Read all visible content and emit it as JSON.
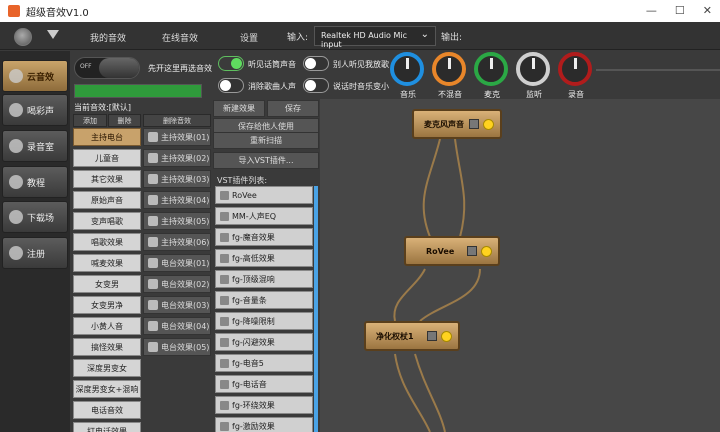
{
  "window": {
    "title": "超级音效V1.0"
  },
  "topbar": {
    "tabs": [
      "我的音效",
      "在线音效",
      "设置"
    ],
    "input_label": "输入:",
    "input_device": "Realtek HD Audio Mic input",
    "output_label": "输出:"
  },
  "sidebar": {
    "items": [
      {
        "label": "云音效",
        "icon": "cloud-icon",
        "active": true
      },
      {
        "label": "喝彩声",
        "icon": "clap-icon",
        "active": false
      },
      {
        "label": "录音室",
        "icon": "mic-icon",
        "active": false
      },
      {
        "label": "教程",
        "icon": "book-icon",
        "active": false
      },
      {
        "label": "下载场",
        "icon": "download-icon",
        "active": false
      },
      {
        "label": "注册",
        "icon": "register-icon",
        "active": false
      }
    ]
  },
  "controls": {
    "main_toggle_text": "OFF",
    "main_toggle_hint": "先开这里再选音效",
    "switches": [
      {
        "label": "听见话筒声音",
        "on": true
      },
      {
        "label": "别人听见我放歌",
        "on": false
      },
      {
        "label": "消除歌曲人声",
        "on": false
      },
      {
        "label": "说话时音乐变小",
        "on": false
      }
    ],
    "knobs": [
      {
        "label": "音乐",
        "color": "#1f8fe0"
      },
      {
        "label": "不混音",
        "color": "#e8862a"
      },
      {
        "label": "麦克",
        "color": "#2ba845"
      },
      {
        "label": "监听",
        "color": "#cfcfcf"
      },
      {
        "label": "录音",
        "color": "#b01c1c"
      }
    ]
  },
  "presets": {
    "header": "当前音效:[默认]",
    "buttons": [
      "添加",
      "删除",
      "删除音效"
    ],
    "left": [
      "主持电台",
      "儿童音",
      "其它效果",
      "原始声音",
      "变声唱歌",
      "唱歌效果",
      "喊麦效果",
      "女变男",
      "女变男净",
      "小黄人音",
      "搞怪效果",
      "深度男变女",
      "深度男变女+混响",
      "电话音效",
      "打电话效果"
    ],
    "right": [
      "主持效果(01)",
      "主持效果(02)",
      "主持效果(03)",
      "主持效果(04)",
      "主持效果(05)",
      "主持效果(06)",
      "电台效果(01)",
      "电台效果(02)",
      "电台效果(03)",
      "电台效果(04)",
      "电台效果(05)"
    ]
  },
  "vst": {
    "buttons": [
      "新建效果",
      "保存",
      "保存给他人使用",
      "重新扫描",
      "导入VST插件..."
    ],
    "list_label": "VST插件列表:",
    "items": [
      "RoVee",
      "MM-人声EQ",
      "fg-魔音效果",
      "fg-高低效果",
      "fg-顶级混响",
      "fg-音量条",
      "fg-降噪限制",
      "fg-闪避效果",
      "fg-电音5",
      "fg-电话音",
      "fg-环绕效果",
      "fg-激励效果"
    ]
  },
  "graph": {
    "nodes": [
      "麦克风声音",
      "RoVee",
      "净化权杖1"
    ]
  }
}
